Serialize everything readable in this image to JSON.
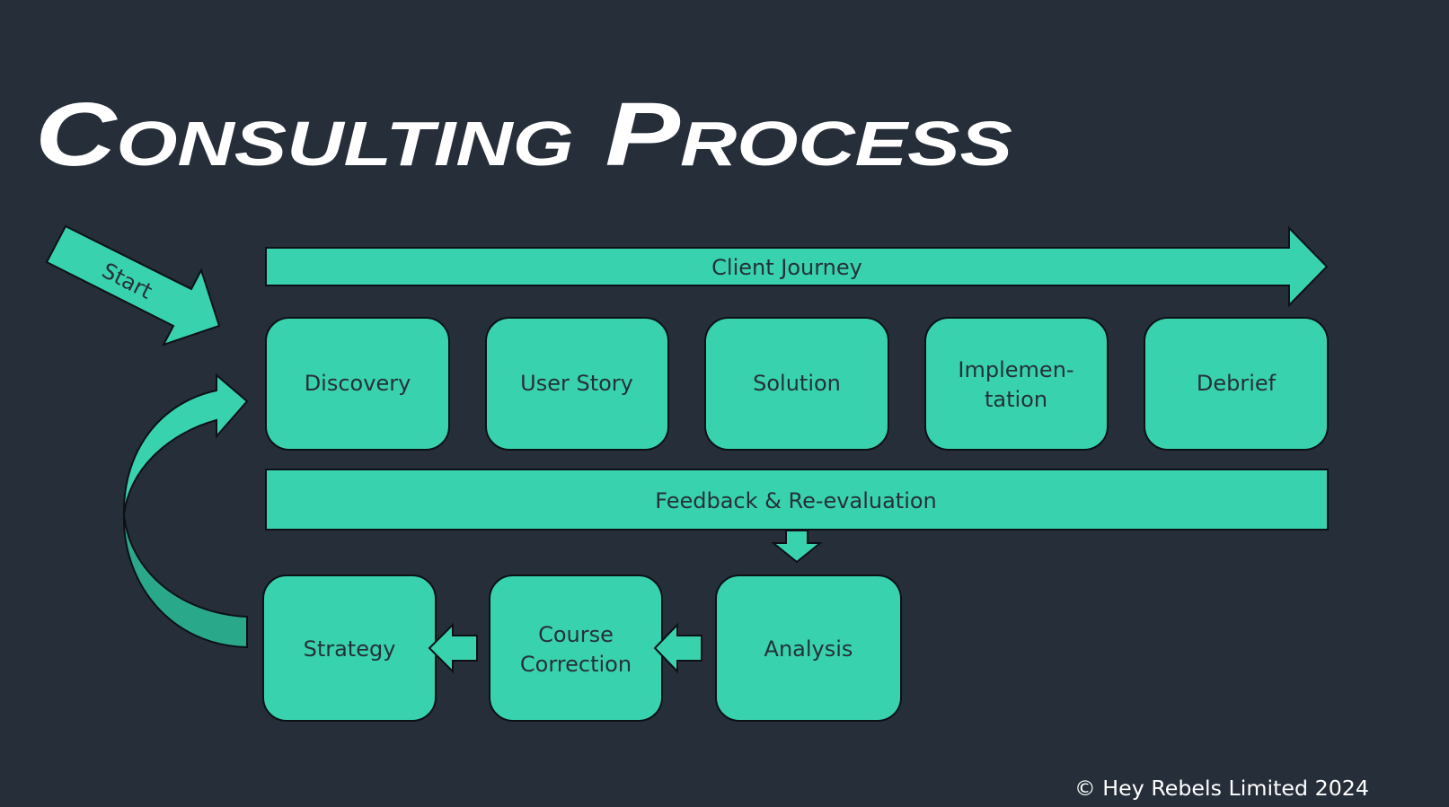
{
  "title": "Consulting Process",
  "colors": {
    "background": "#252e39",
    "shape_fill": "#38d3ae",
    "shape_fill_dark": "#2aa88a",
    "label_text": "#263039",
    "title_text": "#ffffff"
  },
  "start_label": "Start",
  "client_journey_label": "Client Journey",
  "stages": [
    {
      "lines": [
        "Discovery"
      ]
    },
    {
      "lines": [
        "User Story"
      ]
    },
    {
      "lines": [
        "Solution"
      ]
    },
    {
      "lines": [
        "Implemen-",
        "tation"
      ]
    },
    {
      "lines": [
        "Debrief"
      ]
    }
  ],
  "feedback_label": "Feedback & Re-evaluation",
  "loop_stages": [
    {
      "lines": [
        "Strategy"
      ]
    },
    {
      "lines": [
        "Course",
        "Correction"
      ]
    },
    {
      "lines": [
        "Analysis"
      ]
    }
  ],
  "footer": "© Hey Rebels Limited 2024"
}
